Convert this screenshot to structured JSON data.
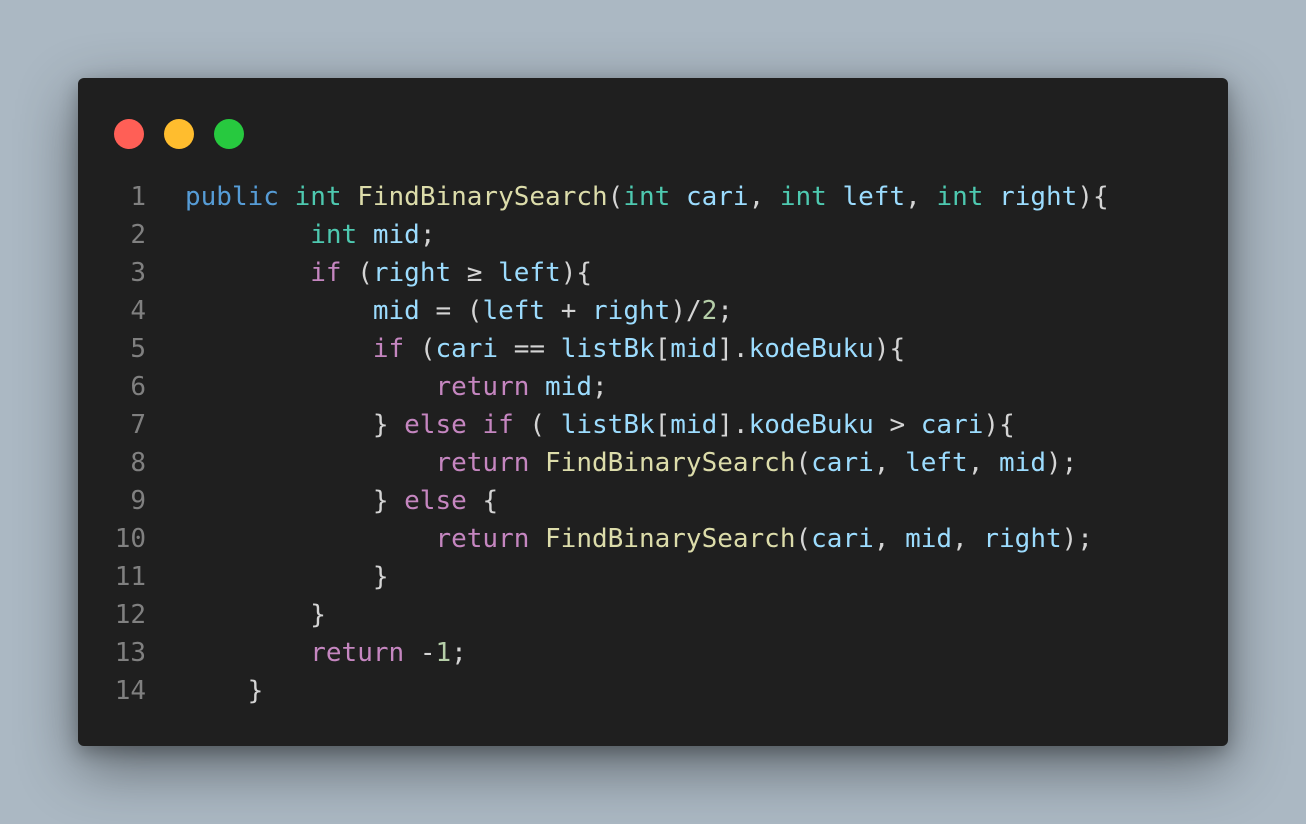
{
  "window": {
    "controls": [
      "close",
      "minimize",
      "maximize"
    ],
    "colors": {
      "close": "#ff5f56",
      "minimize": "#ffbd2e",
      "maximize": "#27c93f",
      "background": "#1f1f1f",
      "page_background": "#abb8c3"
    }
  },
  "code": {
    "line_numbers": [
      "1",
      "2",
      "3",
      "4",
      "5",
      "6",
      "7",
      "8",
      "9",
      "10",
      "11",
      "12",
      "13",
      "14"
    ],
    "lines": [
      "public int FindBinarySearch(int cari, int left, int right){",
      "        int mid;",
      "        if (right ≥ left){",
      "            mid = (left + right)/2;",
      "            if (cari == listBk[mid].kodeBuku){",
      "                return mid;",
      "            } else if ( listBk[mid].kodeBuku > cari){",
      "                return FindBinarySearch(cari, left, mid);",
      "            } else {",
      "                return FindBinarySearch(cari, mid, right);",
      "            }",
      "        }",
      "        return -1;",
      "    }"
    ]
  }
}
